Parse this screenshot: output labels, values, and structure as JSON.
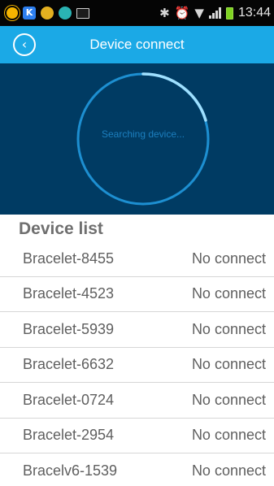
{
  "status_bar": {
    "time": "13:44",
    "icons": [
      "weather-sun-icon",
      "k-app-icon",
      "ball-app-icon",
      "refresh-app-icon",
      "image-icon",
      "bluetooth-icon",
      "alarm-icon",
      "wifi-icon",
      "signal-icon",
      "battery-icon"
    ]
  },
  "app_bar": {
    "title": "Device connect",
    "back_icon": "back-chevron-icon",
    "color": "#1ba9e6"
  },
  "search": {
    "status_text": "Searching device...",
    "background": "#003b63"
  },
  "device_list": {
    "header": "Device list",
    "items": [
      {
        "name": "Bracelet-8455",
        "status": "No connect"
      },
      {
        "name": "Bracelet-4523",
        "status": "No connect"
      },
      {
        "name": "Bracelet-5939",
        "status": "No connect"
      },
      {
        "name": "Bracelet-6632",
        "status": "No connect"
      },
      {
        "name": "Bracelet-0724",
        "status": "No connect"
      },
      {
        "name": "Bracelet-2954",
        "status": "No connect"
      },
      {
        "name": "Bracelv6-1539",
        "status": "No connect"
      }
    ]
  }
}
